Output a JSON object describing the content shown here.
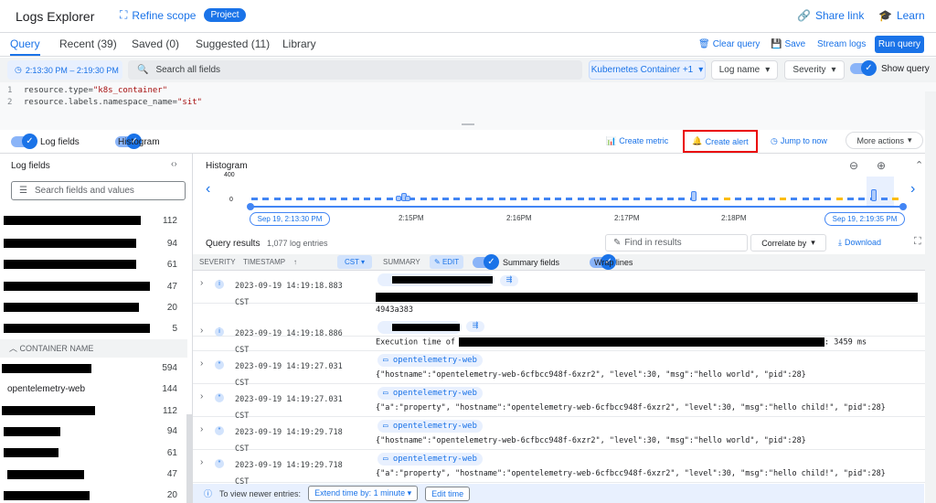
{
  "app": {
    "title": "Logs Explorer",
    "refine_scope": "Refine scope",
    "project_badge": "Project",
    "share_link": "Share link",
    "learn": "Learn"
  },
  "tabs": [
    {
      "label": "Query"
    },
    {
      "label": "Recent (39)"
    },
    {
      "label": "Saved (0)"
    },
    {
      "label": "Suggested (11)"
    },
    {
      "label": "Library"
    }
  ],
  "query_actions": {
    "clear": "Clear query",
    "save": "Save",
    "stream": "Stream logs",
    "run": "Run query"
  },
  "filters": {
    "time_range": "2:13:30 PM – 2:19:30 PM",
    "search_placeholder": "Search all fields",
    "resource": "Kubernetes Container +1",
    "log_name": "Log name",
    "severity": "Severity",
    "show_query": "Show query"
  },
  "editor": {
    "lines": [
      {
        "num": "1",
        "key": "resource.type=",
        "value": "\"k8s_container\""
      },
      {
        "num": "2",
        "key": "resource.labels.namespace_name=",
        "value": "\"sit\""
      }
    ]
  },
  "options": {
    "log_fields": "Log fields",
    "histogram": "Histogram",
    "create_metric": "Create metric",
    "create_alert": "Create alert",
    "jump_to_now": "Jump to now",
    "more_actions": "More actions"
  },
  "log_fields_pane": {
    "title": "Log fields",
    "search_placeholder": "Search fields and values",
    "top_counts": [
      "112",
      "94",
      "61",
      "47",
      "20",
      "5"
    ],
    "section": "CONTAINER NAME",
    "container_items": [
      {
        "label": "",
        "count": "594"
      },
      {
        "label": "opentelemetry-web",
        "count": "144"
      },
      {
        "label": "",
        "count": "112"
      },
      {
        "label": "",
        "count": "94"
      },
      {
        "label": "",
        "count": "61"
      },
      {
        "label": "",
        "count": "47"
      },
      {
        "label": "",
        "count": "20"
      }
    ]
  },
  "histogram": {
    "label": "Histogram",
    "y_max": "400",
    "y_min": "0",
    "start": "Sep 19, 2:13:30 PM",
    "end": "Sep 19, 2:19:35 PM",
    "ticks": [
      "2:15PM",
      "2:16PM",
      "2:17PM",
      "2:18PM"
    ]
  },
  "results": {
    "label": "Query results",
    "count": "1,077 log entries",
    "find_placeholder": "Find in results",
    "correlate": "Correlate by",
    "download": "Download",
    "columns": {
      "severity": "SEVERITY",
      "timestamp": "TIMESTAMP",
      "tz": "CST",
      "summary": "SUMMARY",
      "edit": "EDIT",
      "summary_fields": "Summary fields",
      "wrap_lines": "Wrap lines"
    },
    "rows": [
      {
        "ts": "2023-09-19 14:19:18.883",
        "tz": "CST",
        "chip": "",
        "msg": "4943a383",
        "sev": "i"
      },
      {
        "ts": "2023-09-19 14:19:18.886",
        "tz": "CST",
        "chip": "",
        "msg": "Execution time of",
        "msg_end": ": 3459 ms",
        "sev": "i"
      },
      {
        "ts": "2023-09-19 14:19:27.031",
        "tz": "CST",
        "chip": "opentelemetry-web",
        "msg": "{\"hostname\":\"opentelemetry-web-6cfbcc948f-6xzr2\", \"level\":30, \"msg\":\"hello world\", \"pid\":28}",
        "sev": "*"
      },
      {
        "ts": "2023-09-19 14:19:27.031",
        "tz": "CST",
        "chip": "opentelemetry-web",
        "msg": "{\"a\":\"property\", \"hostname\":\"opentelemetry-web-6cfbcc948f-6xzr2\", \"level\":30, \"msg\":\"hello child!\", \"pid\":28}",
        "sev": "*"
      },
      {
        "ts": "2023-09-19 14:19:29.718",
        "tz": "CST",
        "chip": "opentelemetry-web",
        "msg": "{\"hostname\":\"opentelemetry-web-6cfbcc948f-6xzr2\", \"level\":30, \"msg\":\"hello world\", \"pid\":28}",
        "sev": "*"
      },
      {
        "ts": "2023-09-19 14:19:29.718",
        "tz": "CST",
        "chip": "opentelemetry-web",
        "msg": "{\"a\":\"property\", \"hostname\":\"opentelemetry-web-6cfbcc948f-6xzr2\", \"level\":30, \"msg\":\"hello child!\", \"pid\":28}",
        "sev": "*"
      }
    ]
  },
  "banner": {
    "text": "To view newer entries:",
    "extend": "Extend time by: 1 minute",
    "edit_time": "Edit time"
  },
  "colors": {
    "accent": "#1a73e8",
    "highlight_border": "#ea0000"
  }
}
